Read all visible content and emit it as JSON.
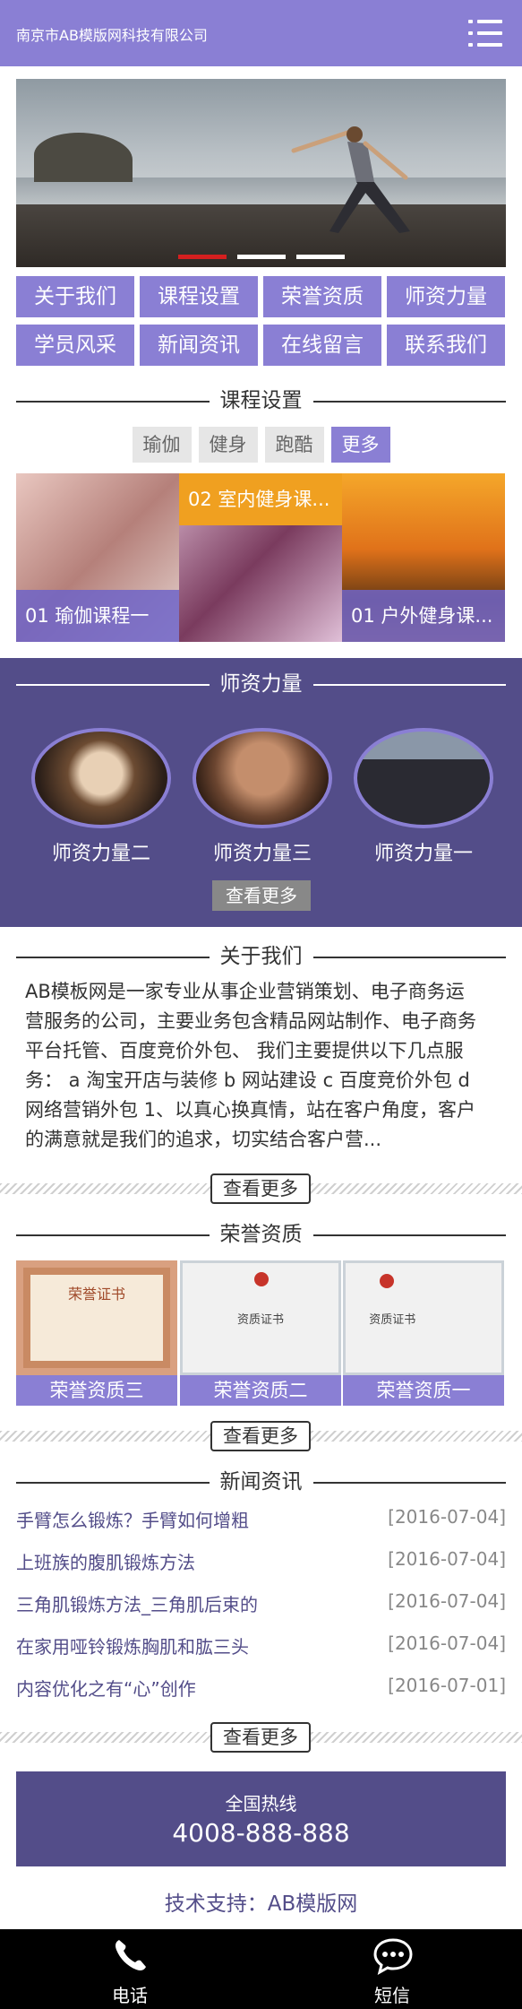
{
  "header": {
    "title": "南京市AB模版网科技有限公司",
    "menu_icon": "menu-icon"
  },
  "nav": [
    "关于我们",
    "课程设置",
    "荣誉资质",
    "师资力量",
    "学员风采",
    "新闻资讯",
    "在线留言",
    "联系我们"
  ],
  "courses_section": {
    "title": "课程设置",
    "tabs": [
      "瑜伽",
      "健身",
      "跑酷",
      "更多"
    ],
    "active_tab": "更多",
    "items": [
      "01 瑜伽课程一",
      "02 室内健身课...",
      "01 户外健身课..."
    ]
  },
  "teachers_section": {
    "title": "师资力量",
    "names": [
      "师资力量二",
      "师资力量三",
      "师资力量一"
    ],
    "more": "查看更多"
  },
  "about_section": {
    "title": "关于我们",
    "text_lines": [
      "AB模板网是一家专业从事企业营销策划、电子商务运",
      "营服务的公司，主要业务包含精品网站制作、电子商务",
      "平台托管、百度竞价外包、 我们主要提供以下几点服",
      "务： a 淘宝开店与装修 b 网站建设 c 百度竞价外包 d",
      "网络营销外包 1、以真心换真情，站在客户角度，客户",
      "的满意就是我们的追求，切实结合客户营..."
    ],
    "more": "查看更多"
  },
  "honors_section": {
    "title": "荣誉资质",
    "items": [
      "荣誉资质三",
      "荣誉资质二",
      "荣誉资质一"
    ],
    "cert_texts": [
      "荣誉证书",
      "资质证书",
      "资质证书"
    ],
    "more": "查看更多"
  },
  "news_section": {
    "title": "新闻资讯",
    "items": [
      {
        "title": "手臂怎么锻炼？手臂如何增粗",
        "date": "[2016-07-04]"
      },
      {
        "title": "上班族的腹肌锻炼方法",
        "date": "[2016-07-04]"
      },
      {
        "title": "三角肌锻炼方法_三角肌后束的",
        "date": "[2016-07-04]"
      },
      {
        "title": "在家用哑铃锻炼胸肌和肱三头",
        "date": "[2016-07-04]"
      },
      {
        "title": "内容优化之有“心”创作",
        "date": "[2016-07-01]"
      }
    ],
    "more": "查看更多"
  },
  "hotline": {
    "label": "全国热线",
    "number": "4008-888-888"
  },
  "support": "技术支持：AB模版网",
  "footer": {
    "phone": "电话",
    "sms": "短信"
  },
  "colors": {
    "primary": "#8a7fd4",
    "dark": "#534d89",
    "banner_dot_active": "#d41f1f",
    "course_badge": "#f0a020"
  }
}
